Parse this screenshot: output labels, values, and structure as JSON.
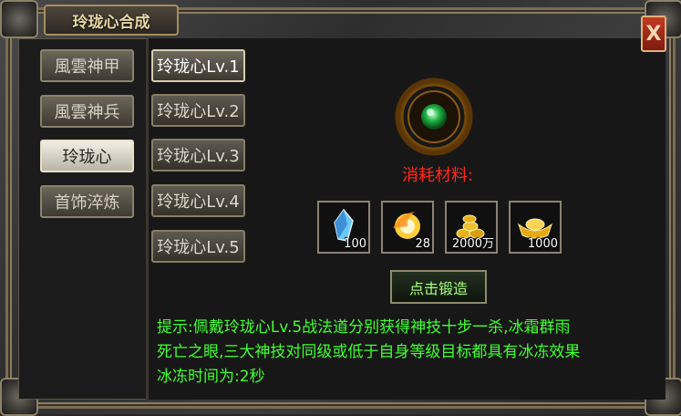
{
  "window": {
    "title": "玲珑心合成",
    "close_label": "X"
  },
  "categories": [
    {
      "label": "風雲神甲",
      "active": false
    },
    {
      "label": "風雲神兵",
      "active": false
    },
    {
      "label": "玲珑心",
      "active": true
    },
    {
      "label": "首饰淬炼",
      "active": false
    }
  ],
  "levels": [
    {
      "label": "玲珑心Lv.1",
      "active": true
    },
    {
      "label": "玲珑心Lv.2",
      "active": false
    },
    {
      "label": "玲珑心Lv.3",
      "active": false
    },
    {
      "label": "玲珑心Lv.4",
      "active": false
    },
    {
      "label": "玲珑心Lv.5",
      "active": false
    }
  ],
  "target_item": {
    "icon": "linglong-heart-ring-icon"
  },
  "cost": {
    "label": "消耗材料:",
    "materials": [
      {
        "icon": "blue-crystal-icon",
        "qty": "100"
      },
      {
        "icon": "fire-orb-icon",
        "qty": "28"
      },
      {
        "icon": "gold-coins-icon",
        "qty": "2000万"
      },
      {
        "icon": "gold-ingot-icon",
        "qty": "1000"
      }
    ]
  },
  "forge_button": {
    "label": "点击锻造"
  },
  "hint": {
    "line1": "提示:佩戴玲珑心Lv.5战法道分别获得神技十步一杀,冰霜群雨",
    "line2": "死亡之眼,三大神技对同级或低于自身等级目标都具有冰冻效果",
    "line3": "冰冻时间为:2秒"
  },
  "colors": {
    "hint_text": "#42ff33",
    "cost_label": "#ff2a1f",
    "forge_text": "#a6ff7a",
    "title_text": "#e6d7a5"
  }
}
